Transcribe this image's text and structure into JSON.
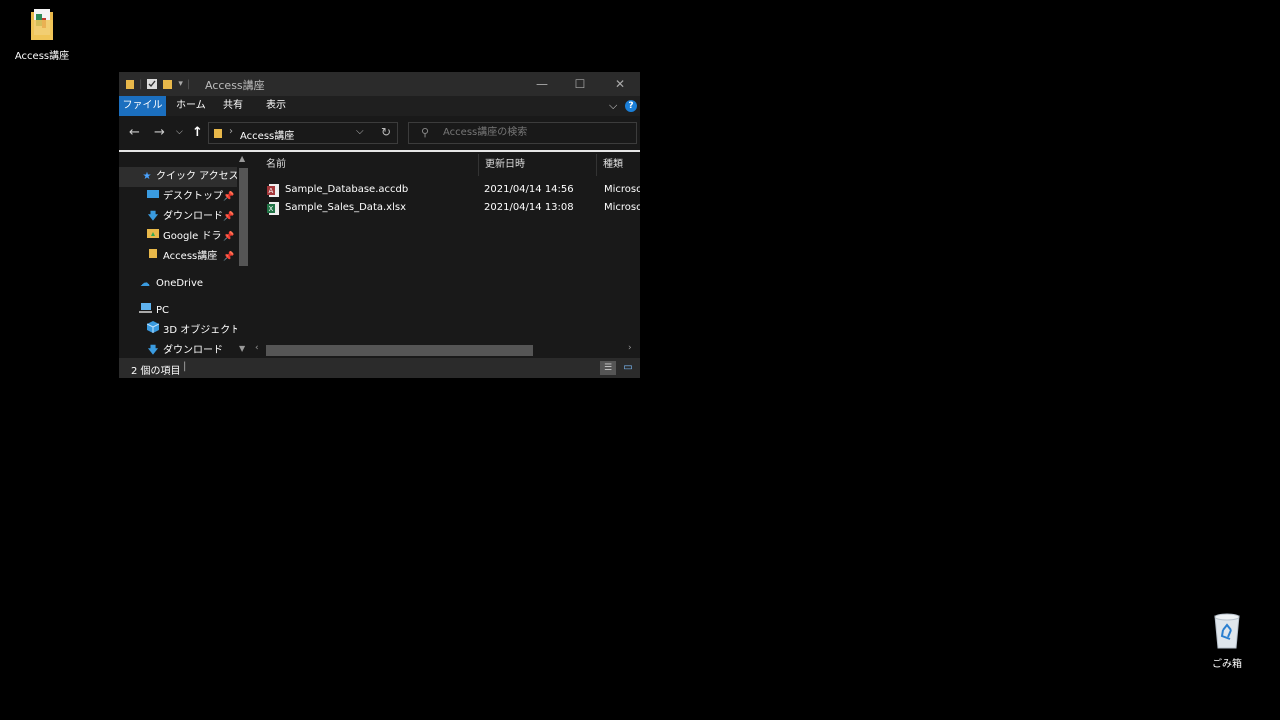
{
  "desktop": {
    "folder_label": "Access講座",
    "trash_label": "ごみ箱"
  },
  "window": {
    "title": "Access講座",
    "minimize": "—",
    "maximize": "☐",
    "close": "✕"
  },
  "ribbon": {
    "tabs": [
      "ファイル",
      "ホーム",
      "共有",
      "表示"
    ],
    "help": "?"
  },
  "address": {
    "path": "Access講座",
    "search_placeholder": "Access講座の検索"
  },
  "nav": {
    "quick_access": "クイック アクセス",
    "items": [
      {
        "label": "デスクトップ",
        "icon": "desktop-icon"
      },
      {
        "label": "ダウンロード",
        "icon": "download-icon"
      },
      {
        "label": "Google ドライブ",
        "icon": "google-drive-icon"
      },
      {
        "label": "Access講座",
        "icon": "folder-icon"
      }
    ],
    "onedrive": "OneDrive",
    "pc": "PC",
    "pc_items": [
      {
        "label": "3D オブジェクト",
        "icon": "3d-objects-icon"
      },
      {
        "label": "ダウンロード",
        "icon": "download-icon"
      }
    ]
  },
  "columns": {
    "name": "名前",
    "modified": "更新日時",
    "type": "種類"
  },
  "files": [
    {
      "name": "Sample_Database.accdb",
      "modified": "2021/04/14 14:56",
      "type": "Microso",
      "icon": "access-file-icon"
    },
    {
      "name": "Sample_Sales_Data.xlsx",
      "modified": "2021/04/14 13:08",
      "type": "Microso",
      "icon": "excel-file-icon"
    }
  ],
  "status": {
    "count": "2 個の項目"
  },
  "colors": {
    "accent": "#1b6fbf",
    "folder": "#e8b84a",
    "access": "#a4373a",
    "excel": "#217346"
  }
}
